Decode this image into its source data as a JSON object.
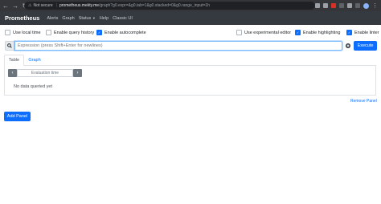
{
  "browser": {
    "back": "←",
    "forward": "→",
    "reload": "↻",
    "security_label": "Not secure",
    "url_host": "prometheus.mekty.me",
    "url_path": "/graph?g0.expr=&g0.tab=1&g0.stacked=0&g0.range_input=1h"
  },
  "app": {
    "brand": "Prometheus",
    "nav": [
      "Alerts",
      "Graph",
      "Status",
      "Help",
      "Classic UI"
    ]
  },
  "options": {
    "local_time": "Use local time",
    "query_history": "Enable query history",
    "autocomplete": "Enable autocomplete",
    "experimental_editor": "Use experimental editor",
    "highlighting": "Enable highlighting",
    "linter": "Enable linter"
  },
  "expression": {
    "placeholder": "Expression (press Shift+Enter for newlines)",
    "execute_label": "Execute"
  },
  "tabs": {
    "table": "Table",
    "graph": "Graph"
  },
  "table_panel": {
    "eval_placeholder": "Evaluation time",
    "empty_text": "No data queried yet"
  },
  "panel_actions": {
    "remove": "Remove Panel",
    "add": "Add Panel"
  },
  "colors": {
    "primary": "#0d6efd",
    "navbar": "#343a40",
    "browser_chrome": "#35363a"
  }
}
